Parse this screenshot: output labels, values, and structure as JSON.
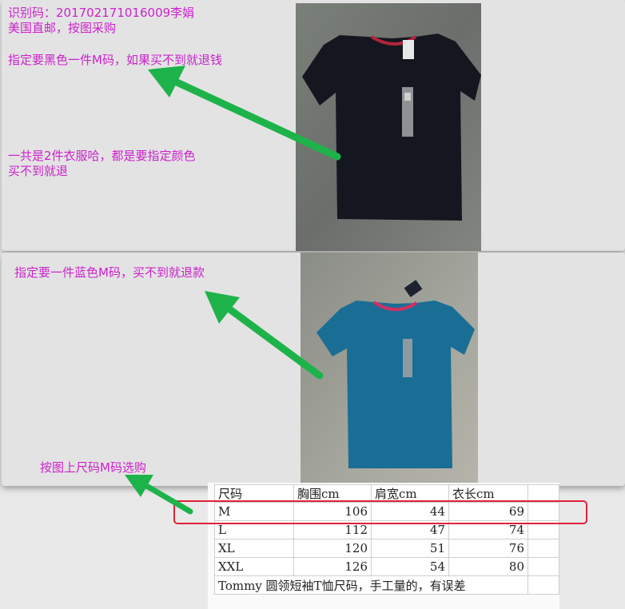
{
  "panel1": {
    "note_id": "识别码：201702171016009李娟",
    "note_shipping": "美国直邮，按图采购",
    "note_black": "指定要黑色一件M码，如果买不到就退钱",
    "note_total_line1": "一共是2件衣服哈，都是要指定颜色",
    "note_total_line2": "买不到就退",
    "photo": {
      "description_icon": "black-tshirt-image",
      "shirt_color": "#14171f"
    }
  },
  "panel2": {
    "note_blue": "指定要一件蓝色M码，买不到就退款",
    "note_size": "按图上尺码M码选购",
    "photo": {
      "description_icon": "blue-tshirt-image",
      "shirt_color": "#1a6e96"
    }
  },
  "size_table": {
    "headers": [
      "尺码",
      "胸围cm",
      "肩宽cm",
      "衣长cm"
    ],
    "rows": [
      {
        "size": "M",
        "chest": "106",
        "shoulder": "44",
        "length": "69"
      },
      {
        "size": "L",
        "chest": "112",
        "shoulder": "47",
        "length": "74"
      },
      {
        "size": "XL",
        "chest": "120",
        "shoulder": "51",
        "length": "76"
      },
      {
        "size": "XXL",
        "chest": "126",
        "shoulder": "54",
        "length": "80"
      }
    ],
    "footnote": "Tommy 圆领短袖T恤尺码，手工量的，有误差",
    "highlight_color": "#e0203a"
  },
  "colors": {
    "note_text": "#cc22cc",
    "arrow": "#1db34a"
  }
}
